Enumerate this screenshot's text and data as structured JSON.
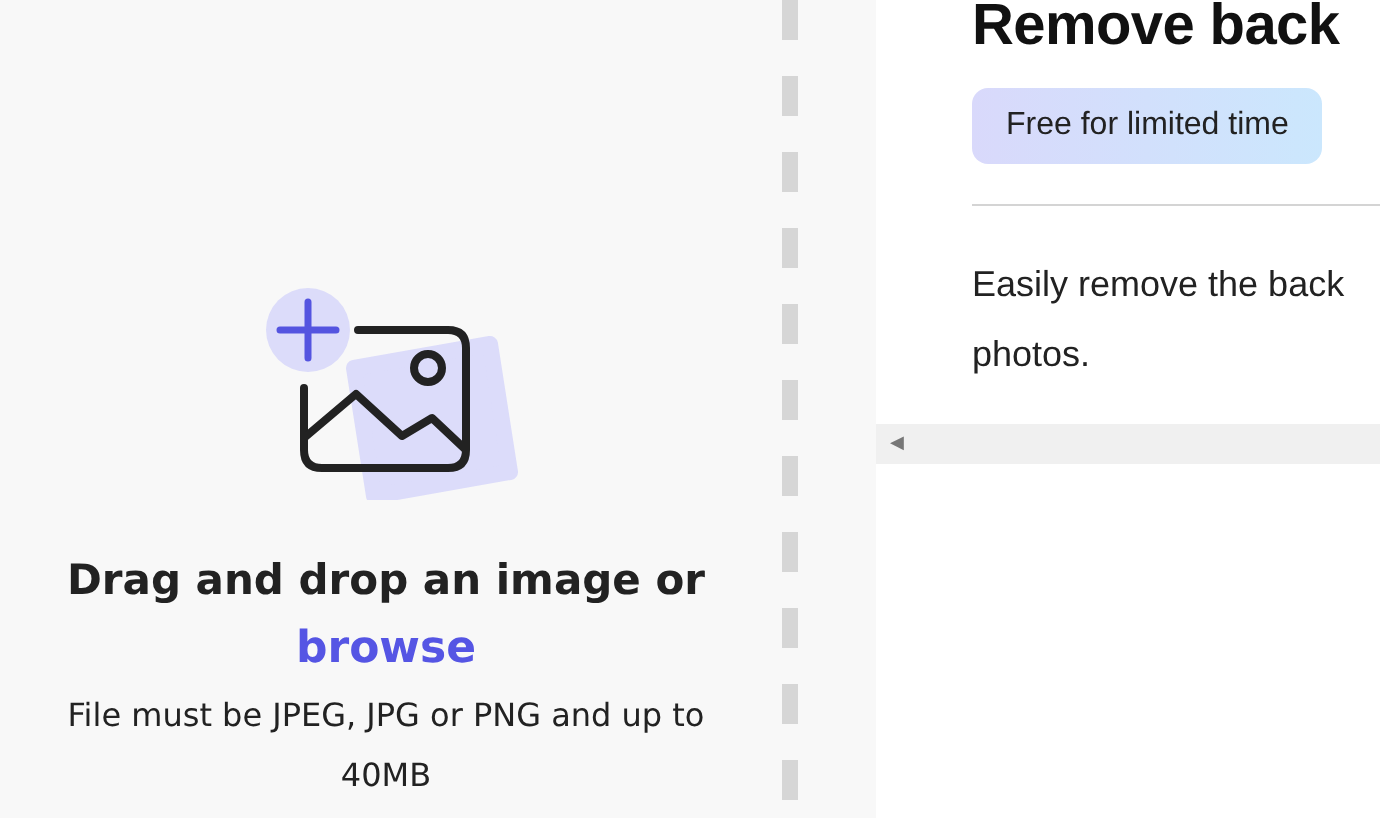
{
  "upload_panel": {
    "prompt": "Drag and drop an image or",
    "browse_link": "browse",
    "note": "File must be JPEG, JPG or PNG and up to 40MB"
  },
  "content": {
    "title": "Remove back",
    "badge": "Free for limited time",
    "description_lines": [
      "Easily remove the back",
      "photos."
    ]
  },
  "scrollbar": {
    "arrow": "◀"
  }
}
